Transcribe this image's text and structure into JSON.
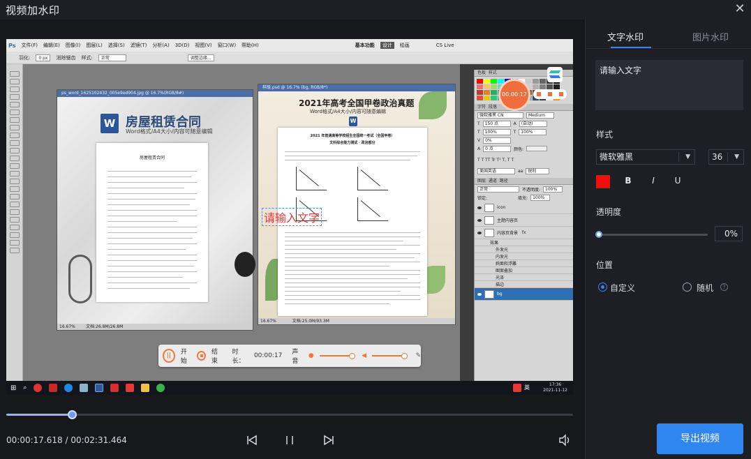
{
  "window": {
    "title": "视频加水印",
    "close_glyph": "✕"
  },
  "video_preview": {
    "ps_menu": [
      "Ps",
      "文件(F)",
      "编辑(E)",
      "图像(I)",
      "图层(L)",
      "选择(S)",
      "滤镜(T)",
      "分析(A)",
      "3D(D)",
      "视图(V)",
      "窗口(W)",
      "帮助(H)"
    ],
    "ps_opt": {
      "feather_label": "羽化:",
      "feather_value": "0 px",
      "antialias": "消除锯齿",
      "style_label": "样式:",
      "style_value": "正常",
      "refine": "调整边缘...",
      "workspace": "基本功能",
      "design": "设计",
      "paint": "绘画",
      "cslive": "CS Live"
    },
    "doc1": {
      "title": "ps_word_1625102432_005e9ed904.jpg @ 16.7%(RGB/8#)",
      "heading": "房屋租赁合同",
      "sub": "Word格式/A4大小/内容可随意编辑",
      "paper_title": "房屋租赁合同",
      "zoom": "16.67%",
      "status": "文档:26.8M/26.8M"
    },
    "doc2": {
      "title": "样版.psd @ 16.7% (bg, RGB/8*)",
      "heading": "2021年高考全国甲卷政治真题",
      "sub": "Word格式/A4大小/内容可随意编辑",
      "paper_title": "2021 年普通高等学校招生全国统一考试（全国甲卷）",
      "paper_sub": "文科综合能力测试 · 政治部分",
      "zoom": "16.67%",
      "status": "文档:25.0M/93.3M"
    },
    "watermark_text": "请输入文字",
    "rec_timer": "00:00:17",
    "panels": {
      "tabs1": [
        "色板",
        "样式"
      ],
      "tabs2": [
        "字符",
        "段落"
      ],
      "font": "微软雅黑 CN",
      "weight": "Medium",
      "size": "150 点",
      "leading": "(自动)",
      "tracking_scale": "100%",
      "tracking_scale2": "100%",
      "kerning": "0%",
      "baseline": "0 点",
      "color_label": "颜色:",
      "lang": "美国英语",
      "aa": "锐利",
      "layers_tabs": [
        "图层",
        "通道",
        "路径"
      ],
      "blend": "正常",
      "opacity_label": "不透明度:",
      "opacity_val": "100%",
      "lock_label": "锁定:",
      "fill_label": "填充:",
      "fill_val": "100%",
      "layers": [
        "icon",
        "主题内容页",
        "内容页背景",
        "效果",
        "外发光",
        "内发光",
        "斜面和浮雕",
        "图案叠加",
        "光泽",
        "描边",
        "bg"
      ]
    },
    "recbar": {
      "start": "开始",
      "end": "结束",
      "duration_label": "时长：",
      "duration": "00:00:17",
      "sound": "声音"
    },
    "taskbar": {
      "time": "17:36",
      "date": "2021-11-12",
      "ime": "英"
    }
  },
  "player": {
    "current": "00:00:17.618",
    "total": "00:02:31.464",
    "separator": "/",
    "progress": 0.116
  },
  "panel": {
    "tabs": [
      {
        "label": "文字水印",
        "active": true
      },
      {
        "label": "图片水印",
        "active": false
      }
    ],
    "text_value": "请输入文字",
    "style_label": "样式",
    "font": "微软雅黑",
    "font_size": "36",
    "color": "#f20d0d",
    "bold": "B",
    "italic": "I",
    "underline": "U",
    "opacity_label": "透明度",
    "opacity_value": "0%",
    "opacity": 0,
    "position_label": "位置",
    "pos_custom": "自定义",
    "pos_random": "随机",
    "help": "?",
    "export": "导出视频"
  }
}
